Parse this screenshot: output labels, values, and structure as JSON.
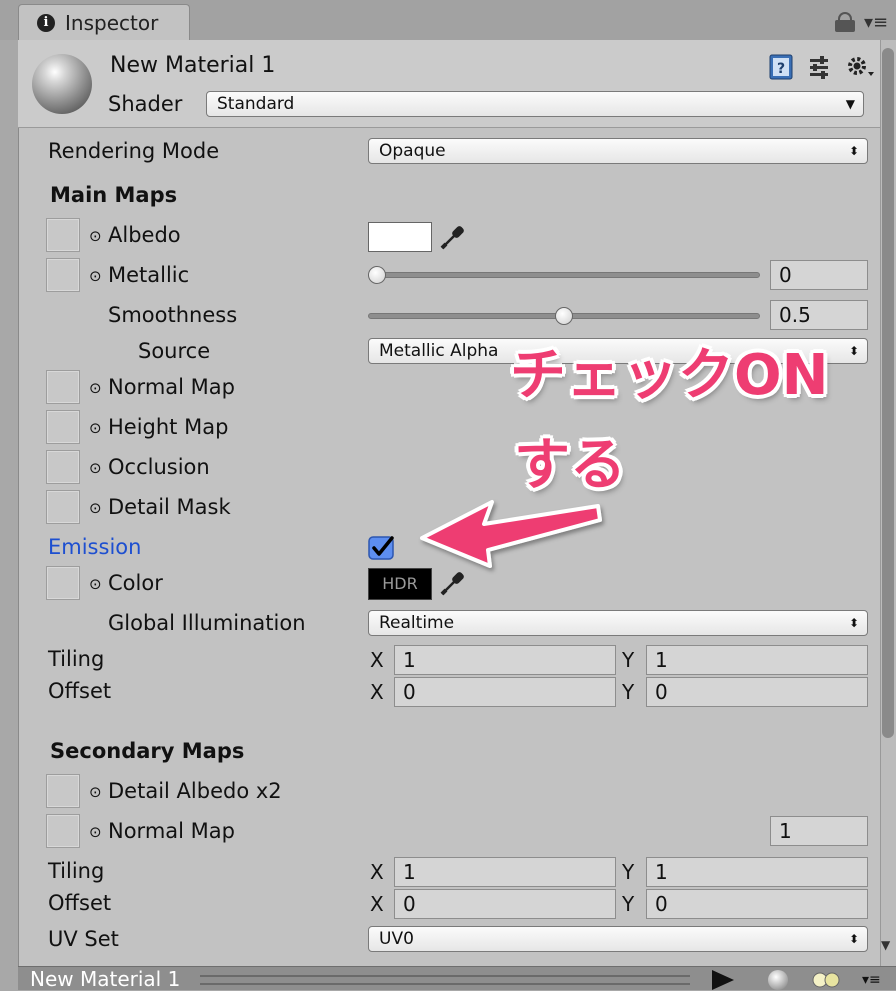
{
  "window": {
    "tab_label": "Inspector",
    "lock_icon": "lock-icon",
    "menu_icon": "menu-icon"
  },
  "header": {
    "material_name": "New Material 1",
    "shader_label": "Shader",
    "shader_value": "Standard"
  },
  "rendering_mode": {
    "label": "Rendering Mode",
    "value": "Opaque"
  },
  "main_maps": {
    "heading": "Main Maps",
    "albedo": "Albedo",
    "metallic": {
      "label": "Metallic",
      "value": "0",
      "level": 0
    },
    "smoothness": {
      "label": "Smoothness",
      "value": "0.5",
      "level": 0.5
    },
    "source": {
      "label": "Source",
      "value": "Metallic Alpha"
    },
    "normal_map": "Normal Map",
    "height_map": "Height Map",
    "occlusion": "Occlusion",
    "detail_mask": "Detail Mask",
    "emission": {
      "label": "Emission",
      "checked": true,
      "label_color": "#1d4fd0"
    },
    "color": {
      "label": "Color",
      "hdr": "HDR"
    },
    "gi": {
      "label": "Global Illumination",
      "value": "Realtime"
    },
    "tiling": {
      "label": "Tiling",
      "x_label": "X",
      "x": "1",
      "y_label": "Y",
      "y": "1"
    },
    "offset": {
      "label": "Offset",
      "x_label": "X",
      "x": "0",
      "y_label": "Y",
      "y": "0"
    }
  },
  "secondary_maps": {
    "heading": "Secondary Maps",
    "detail_albedo": "Detail Albedo x2",
    "normal_map": {
      "label": "Normal Map",
      "value": "1"
    },
    "tiling": {
      "label": "Tiling",
      "x_label": "X",
      "x": "1",
      "y_label": "Y",
      "y": "1"
    },
    "offset": {
      "label": "Offset",
      "x_label": "X",
      "x": "0",
      "y_label": "Y",
      "y": "0"
    },
    "uv_set": {
      "label": "UV Set",
      "value": "UV0"
    }
  },
  "footer": {
    "title": "New Material 1"
  },
  "annotation": {
    "line1": "チェックON",
    "line2": "する",
    "color": "#ee3d72"
  }
}
